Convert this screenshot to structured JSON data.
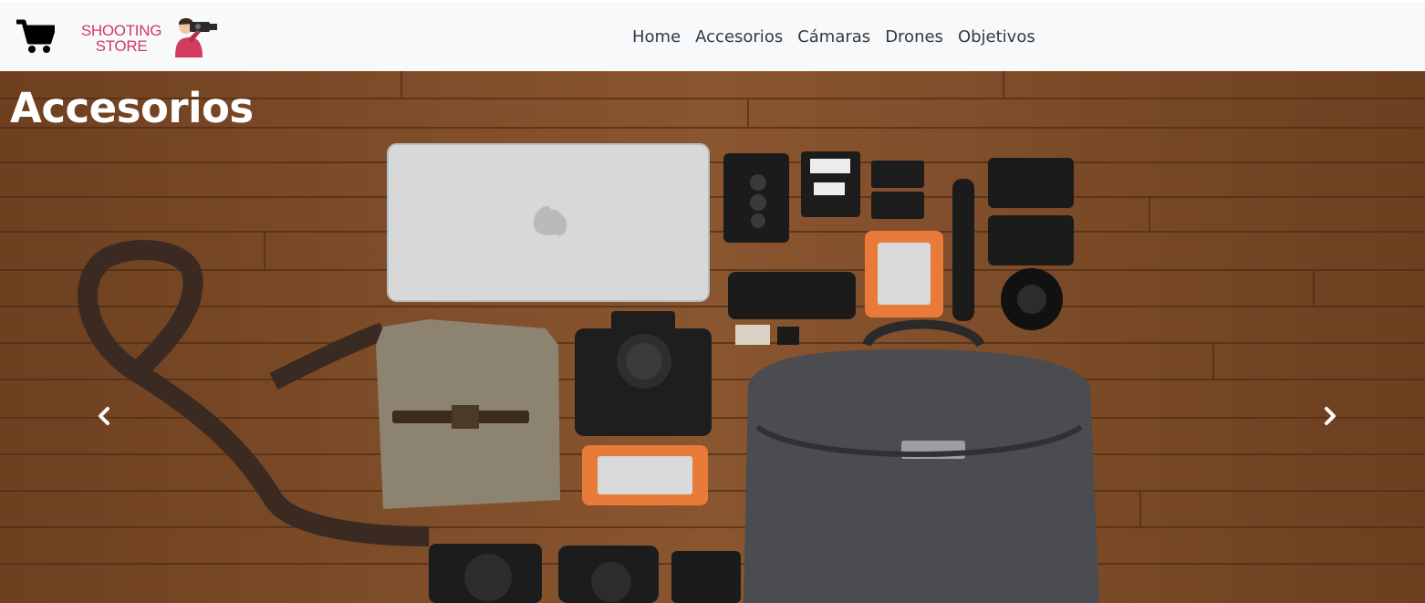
{
  "brand": {
    "line1": "SHOOTING",
    "line2": "STORE",
    "color": "#d23a5f"
  },
  "icons": {
    "cart": "shopping-cart-icon",
    "photographer": "photographer-icon",
    "prev": "chevron-left-icon",
    "next": "chevron-right-icon"
  },
  "nav": {
    "items": [
      "Home",
      "Accesorios",
      "Cámaras",
      "Drones",
      "Objetivos"
    ]
  },
  "hero": {
    "title": "Accesorios"
  },
  "colors": {
    "navbar_bg": "#f8f9fa",
    "nav_text": "#343a40",
    "floor": "#7a4a22"
  }
}
